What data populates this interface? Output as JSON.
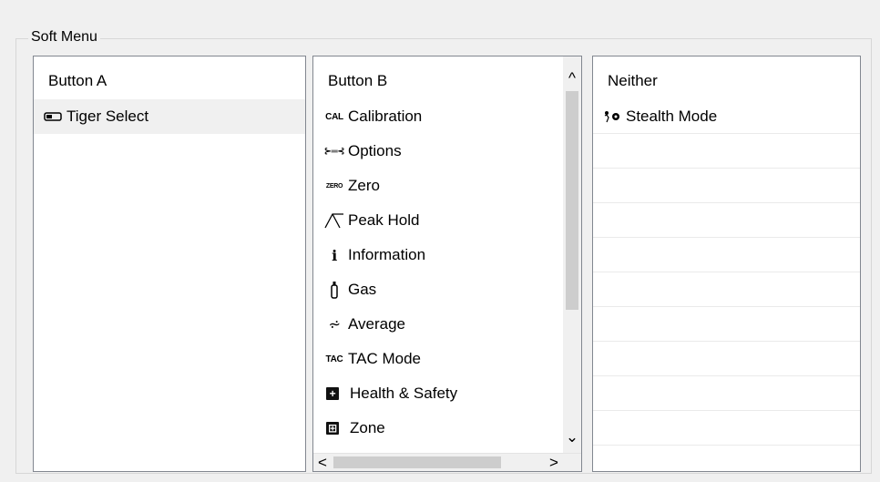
{
  "group": {
    "title": "Soft Menu"
  },
  "button_a": {
    "header": "Button A",
    "items": [
      {
        "icon": "tiger-select-icon",
        "label": "Tiger Select"
      }
    ]
  },
  "button_b": {
    "header": "Button B",
    "items": [
      {
        "icon_text": "CAL",
        "label": "Calibration"
      },
      {
        "icon_text": "⊱═⊰",
        "label": "Options"
      },
      {
        "icon_text": "ZERO",
        "label": "Zero"
      },
      {
        "icon_text": "⋀",
        "label": "Peak Hold"
      },
      {
        "icon_text": "i",
        "label": "Information"
      },
      {
        "icon_text": "⍟",
        "label": "Gas"
      },
      {
        "icon_text": "⩫",
        "label": "Average"
      },
      {
        "icon_text": "TAC",
        "label": "TAC Mode"
      },
      {
        "icon_text": "+",
        "label": "Health & Safety"
      },
      {
        "icon_text": "⊞",
        "label": "Zone"
      }
    ]
  },
  "neither": {
    "header": "Neither",
    "items": [
      {
        "icon": "stealth-mode-icon",
        "label": "Stealth Mode"
      }
    ]
  },
  "scroll": {
    "up": "^",
    "down": "⌄",
    "left": "<",
    "right": ">"
  }
}
